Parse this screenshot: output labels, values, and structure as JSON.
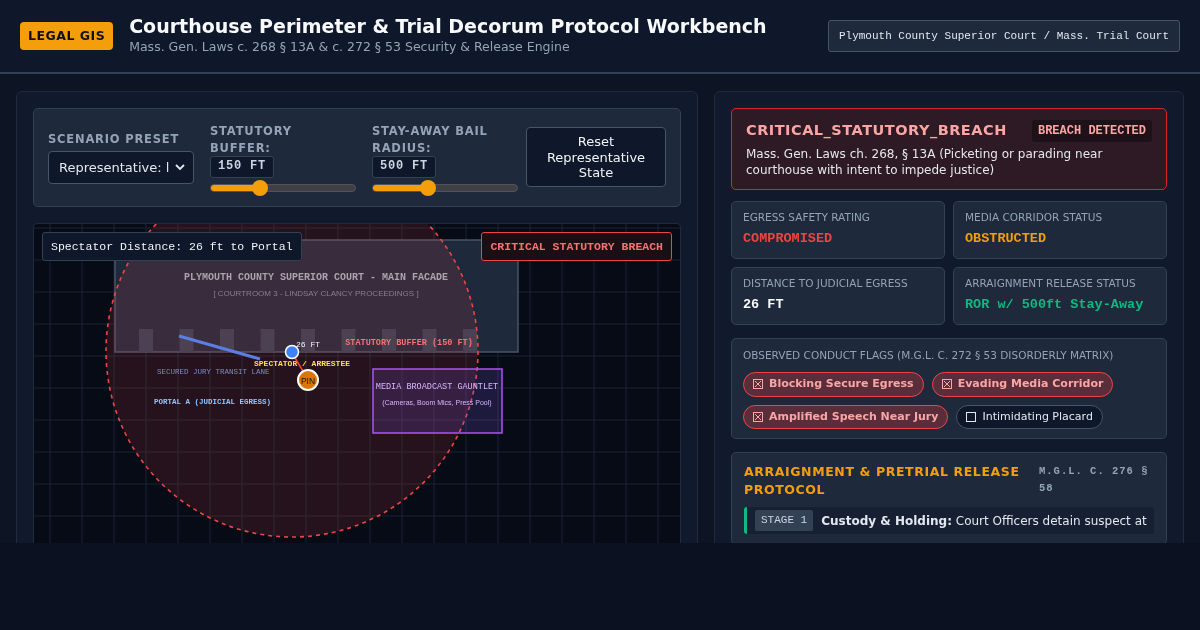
{
  "header": {
    "badge": "LEGAL GIS",
    "title": "Courthouse Perimeter & Trial Decorum Protocol Workbench",
    "subtitle": "Mass. Gen. Laws c. 268 § 13A & c. 272 § 53 Security & Release Engine",
    "jurisdiction": "Plymouth County Superior Court / Mass. Trial Court"
  },
  "controls": {
    "preset": {
      "label": "SCENARIO PRESET",
      "value": "Representative: l"
    },
    "sliders": [
      {
        "label": "STATUTORY BUFFER:",
        "reading": "150 FT",
        "level": 0.34
      },
      {
        "label": "STAY-AWAY BAIL RADIUS:",
        "reading": "500 FT",
        "level": 0.38
      }
    ],
    "reset": "Reset Representative State"
  },
  "map": {
    "distance": "Spectator Distance: 26 ft to Portal",
    "alert": "CRITICAL STATUTORY BREACH",
    "building_title": "PLYMOUTH COUNTY SUPERIOR COURT - MAIN FACADE",
    "building_sub": "[ COURTROOM 3 - LINDSAY CLANCY PROCEEDINGS ]",
    "buffer_label": "STATUTORY BUFFER (150 FT)",
    "lane_label": "SECURED JURY TRANSIT LANE",
    "portal_label": "PORTAL A (JUDICIAL EGRESS)",
    "spectator_label": "SPECTATOR / ARRESTEE",
    "gap_label": "26 FT",
    "pin": "PIN",
    "media_title": "MEDIA BROADCAST GAUNTLET",
    "media_sub": "(Cameras, Boom Mics, Press Pool)"
  },
  "breach": {
    "code": "CRITICAL_STATUTORY_BREACH",
    "tag": "BREACH DETECTED",
    "text": "Mass. Gen. Laws ch. 268, § 13A (Picketing or parading near courthouse with intent to impede justice)"
  },
  "metrics": [
    {
      "label": "EGRESS SAFETY RATING",
      "value": "COMPROMISED",
      "color": "#ef4444"
    },
    {
      "label": "MEDIA CORRIDOR STATUS",
      "value": "OBSTRUCTED",
      "color": "#f59e0b"
    },
    {
      "label": "DISTANCE TO JUDICIAL EGRESS",
      "value": "26 FT",
      "color": "#f8fafc"
    },
    {
      "label": "ARRAIGNMENT RELEASE STATUS",
      "value": "ROR w/ 500ft Stay-Away",
      "color": "#10b981"
    }
  ],
  "flags": {
    "title": "OBSERVED CONDUCT FLAGS (M.G.L. C. 272 § 53 DISORDERLY MATRIX)",
    "items": [
      {
        "label": "Blocking Secure Egress",
        "checked": true
      },
      {
        "label": "Evading Media Corridor",
        "checked": true
      },
      {
        "label": "Amplified Speech Near Jury",
        "checked": true
      },
      {
        "label": "Intimidating Placard",
        "checked": false
      }
    ]
  },
  "protocol": {
    "title": "ARRAIGNMENT & PRETRIAL RELEASE PROTOCOL",
    "cite": "M.G.L. C. 276 § 58",
    "stages": [
      {
        "badge": "STAGE 1",
        "text": "**Custody & Holding:** Court Officers detain suspect at"
      }
    ]
  }
}
